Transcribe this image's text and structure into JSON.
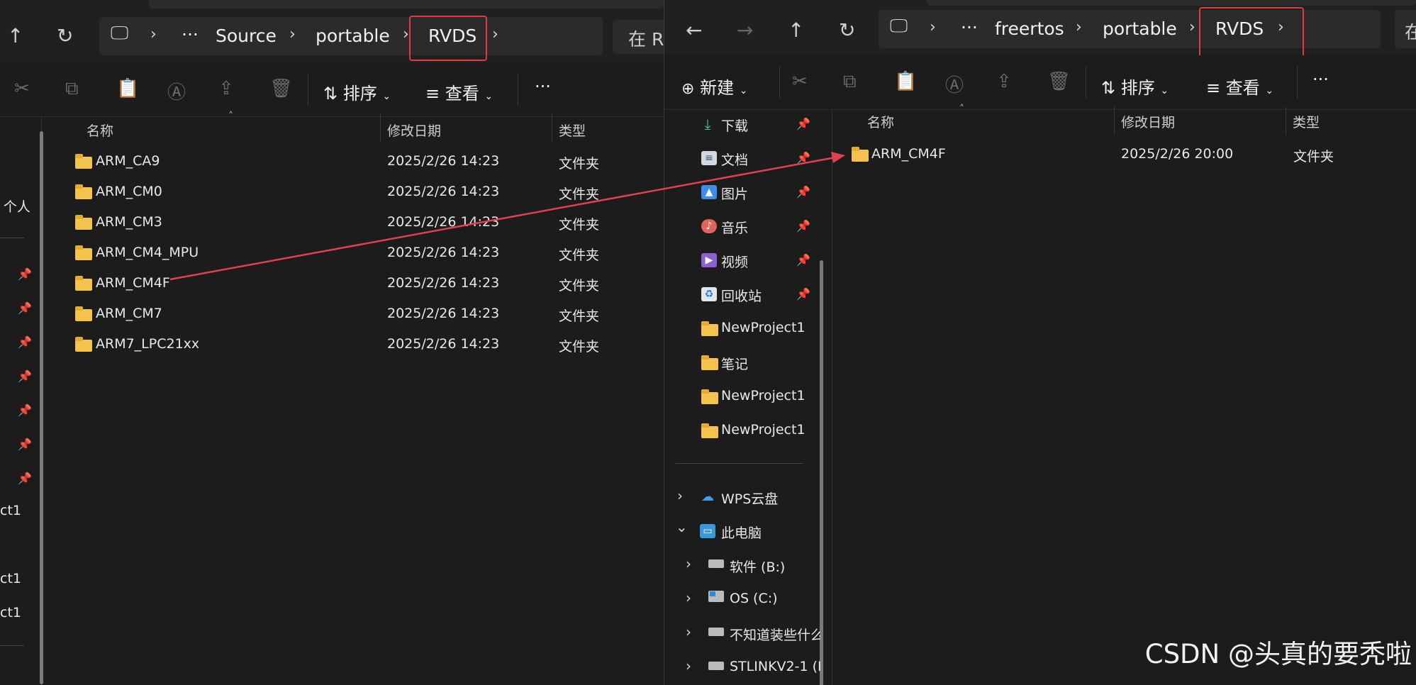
{
  "left": {
    "breadcrumb": [
      "···",
      "Source",
      "portable",
      "RVDS"
    ],
    "search_partial": "在 R",
    "toolbar": {
      "sort": "排序",
      "view": "查看",
      "more": "···"
    },
    "columns": {
      "name": "名称",
      "date": "修改日期",
      "type": "类型"
    },
    "files": [
      {
        "name": "ARM_CA9",
        "date": "2025/2/26 14:23",
        "type": "文件夹"
      },
      {
        "name": "ARM_CM0",
        "date": "2025/2/26 14:23",
        "type": "文件夹"
      },
      {
        "name": "ARM_CM3",
        "date": "2025/2/26 14:23",
        "type": "文件夹"
      },
      {
        "name": "ARM_CM4_MPU",
        "date": "2025/2/26 14:23",
        "type": "文件夹"
      },
      {
        "name": "ARM_CM4F",
        "date": "2025/2/26 14:23",
        "type": "文件夹"
      },
      {
        "name": "ARM_CM7",
        "date": "2025/2/26 14:23",
        "type": "文件夹"
      },
      {
        "name": "ARM7_LPC21xx",
        "date": "2025/2/26 14:23",
        "type": "文件夹"
      }
    ],
    "sidebar_partial": [
      "- 个人",
      "ct1",
      "ct1",
      "ct1"
    ]
  },
  "right": {
    "breadcrumb": [
      "···",
      "freertos",
      "portable",
      "RVDS"
    ],
    "search_partial": "在",
    "toolbar": {
      "new": "新建",
      "sort": "排序",
      "view": "查看",
      "more": "···"
    },
    "columns": {
      "name": "名称",
      "date": "修改日期",
      "type": "类型"
    },
    "files": [
      {
        "name": "ARM_CM4F",
        "date": "2025/2/26 20:00",
        "type": "文件夹"
      }
    ],
    "quick_access": [
      {
        "label": "下载",
        "icon": "download-icon"
      },
      {
        "label": "文档",
        "icon": "document-icon"
      },
      {
        "label": "图片",
        "icon": "pictures-icon"
      },
      {
        "label": "音乐",
        "icon": "music-icon"
      },
      {
        "label": "视频",
        "icon": "video-icon"
      },
      {
        "label": "回收站",
        "icon": "recycle-bin-icon"
      },
      {
        "label": "NewProject1",
        "icon": "folder-icon"
      },
      {
        "label": "笔记",
        "icon": "folder-icon"
      },
      {
        "label": "NewProject1",
        "icon": "folder-icon"
      },
      {
        "label": "NewProject1",
        "icon": "folder-icon"
      }
    ],
    "tree": [
      {
        "label": "WPS云盘",
        "icon": "cloud-icon",
        "chevron": "›"
      },
      {
        "label": "此电脑",
        "icon": "computer-icon",
        "chevron": "⌄"
      },
      {
        "label": "软件 (B:)",
        "icon": "drive-icon",
        "chevron": "›"
      },
      {
        "label": "OS (C:)",
        "icon": "windows-drive-icon",
        "chevron": "›"
      },
      {
        "label": "不知道装些什么",
        "icon": "drive-icon",
        "chevron": "›"
      },
      {
        "label": "STLINKV2-1 (I",
        "icon": "drive-icon",
        "chevron": "›"
      }
    ]
  },
  "watermark": "CSDN @头真的要秃啦",
  "colors": {
    "highlight": "#e03c3c",
    "folder": "#f4c34d",
    "arrow": "#e04050"
  }
}
